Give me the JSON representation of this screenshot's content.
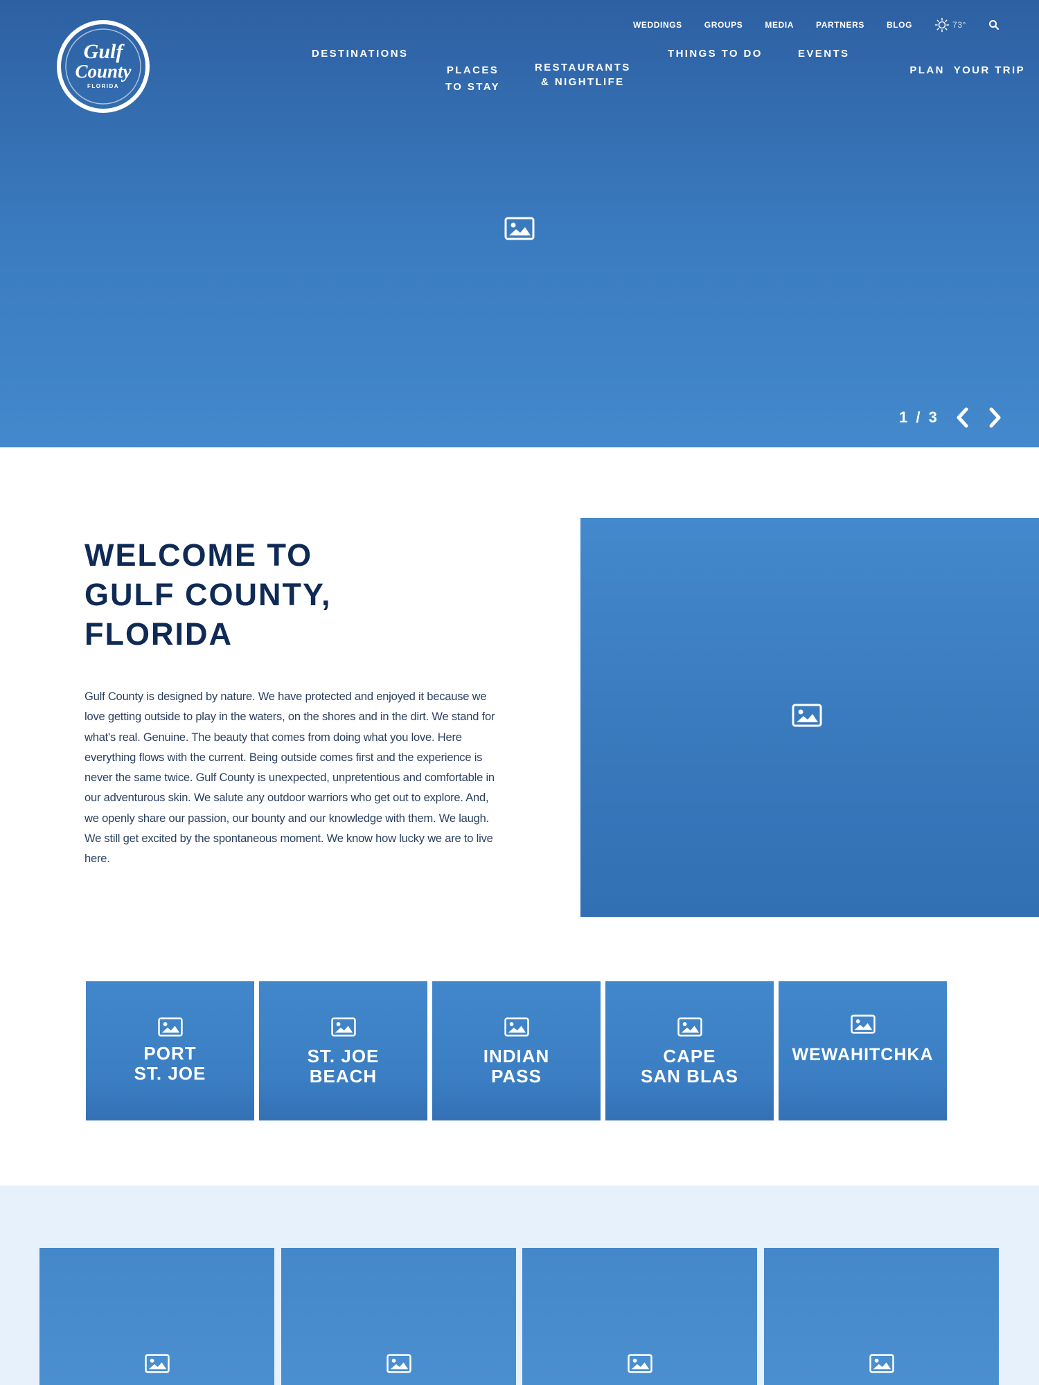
{
  "brand": {
    "logo_line1": "Gulf",
    "logo_line2": "County",
    "logo_line3": "FLORIDA"
  },
  "utility_nav": {
    "items": [
      "WEDDINGS",
      "GROUPS",
      "MEDIA",
      "PARTNERS",
      "BLOG"
    ],
    "weather_icon": "sun-icon",
    "temperature": "73°",
    "search_icon": "search-icon"
  },
  "main_nav": {
    "items": [
      {
        "label": "DESTINATIONS"
      },
      {
        "label": "PLACES\nTO STAY"
      },
      {
        "label": "RESTAURANTS\n& NIGHTLIFE"
      },
      {
        "label": "THINGS TO DO"
      },
      {
        "label": "EVENTS"
      },
      {
        "label": "PLAN  YOUR TRIP"
      }
    ]
  },
  "hero": {
    "image_icon": "image-placeholder-icon",
    "slide_counter": "1 / 3",
    "prev_icon": "chevron-left-icon",
    "next_icon": "chevron-right-icon"
  },
  "welcome": {
    "title_line1": "WELCOME TO",
    "title_line2": "GULF COUNTY,",
    "title_line3": "FLORIDA",
    "body": "Gulf County is designed by nature. We have protected and enjoyed it because we love getting outside to play in the waters, on the shores and in the dirt. We stand for what's real. Genuine. The beauty that comes from doing what you love. Here everything flows with the current. Being outside comes first and the experience is never the same twice. Gulf County is unexpected, unpretentious and comfortable in our adventurous skin. We salute any outdoor warriors who get out to explore. And, we openly share our passion, our bounty and our knowledge with them. We laugh. We still get excited by the spontaneous moment. We know how lucky we are to live here.",
    "image_icon": "image-placeholder-icon"
  },
  "destinations": {
    "tiles": [
      {
        "label": "PORT\nST. JOE"
      },
      {
        "label": "ST. JOE\nBEACH"
      },
      {
        "label": "INDIAN\nPASS"
      },
      {
        "label": "CAPE\nSAN BLAS"
      },
      {
        "label": "WEWAHITCHKA"
      }
    ]
  },
  "features": {
    "cards": [
      {
        "icon": "image-placeholder-icon"
      },
      {
        "icon": "image-placeholder-icon"
      },
      {
        "icon": "image-placeholder-icon"
      },
      {
        "icon": "image-placeholder-icon"
      }
    ]
  },
  "colors": {
    "hero_top": "#2d60a2",
    "hero_bottom": "#4389cc",
    "heading": "#0e2a55",
    "body_text": "#2a3f5f",
    "tile_blue": "#3b7ec3",
    "band_background": "#e6f1fb"
  }
}
